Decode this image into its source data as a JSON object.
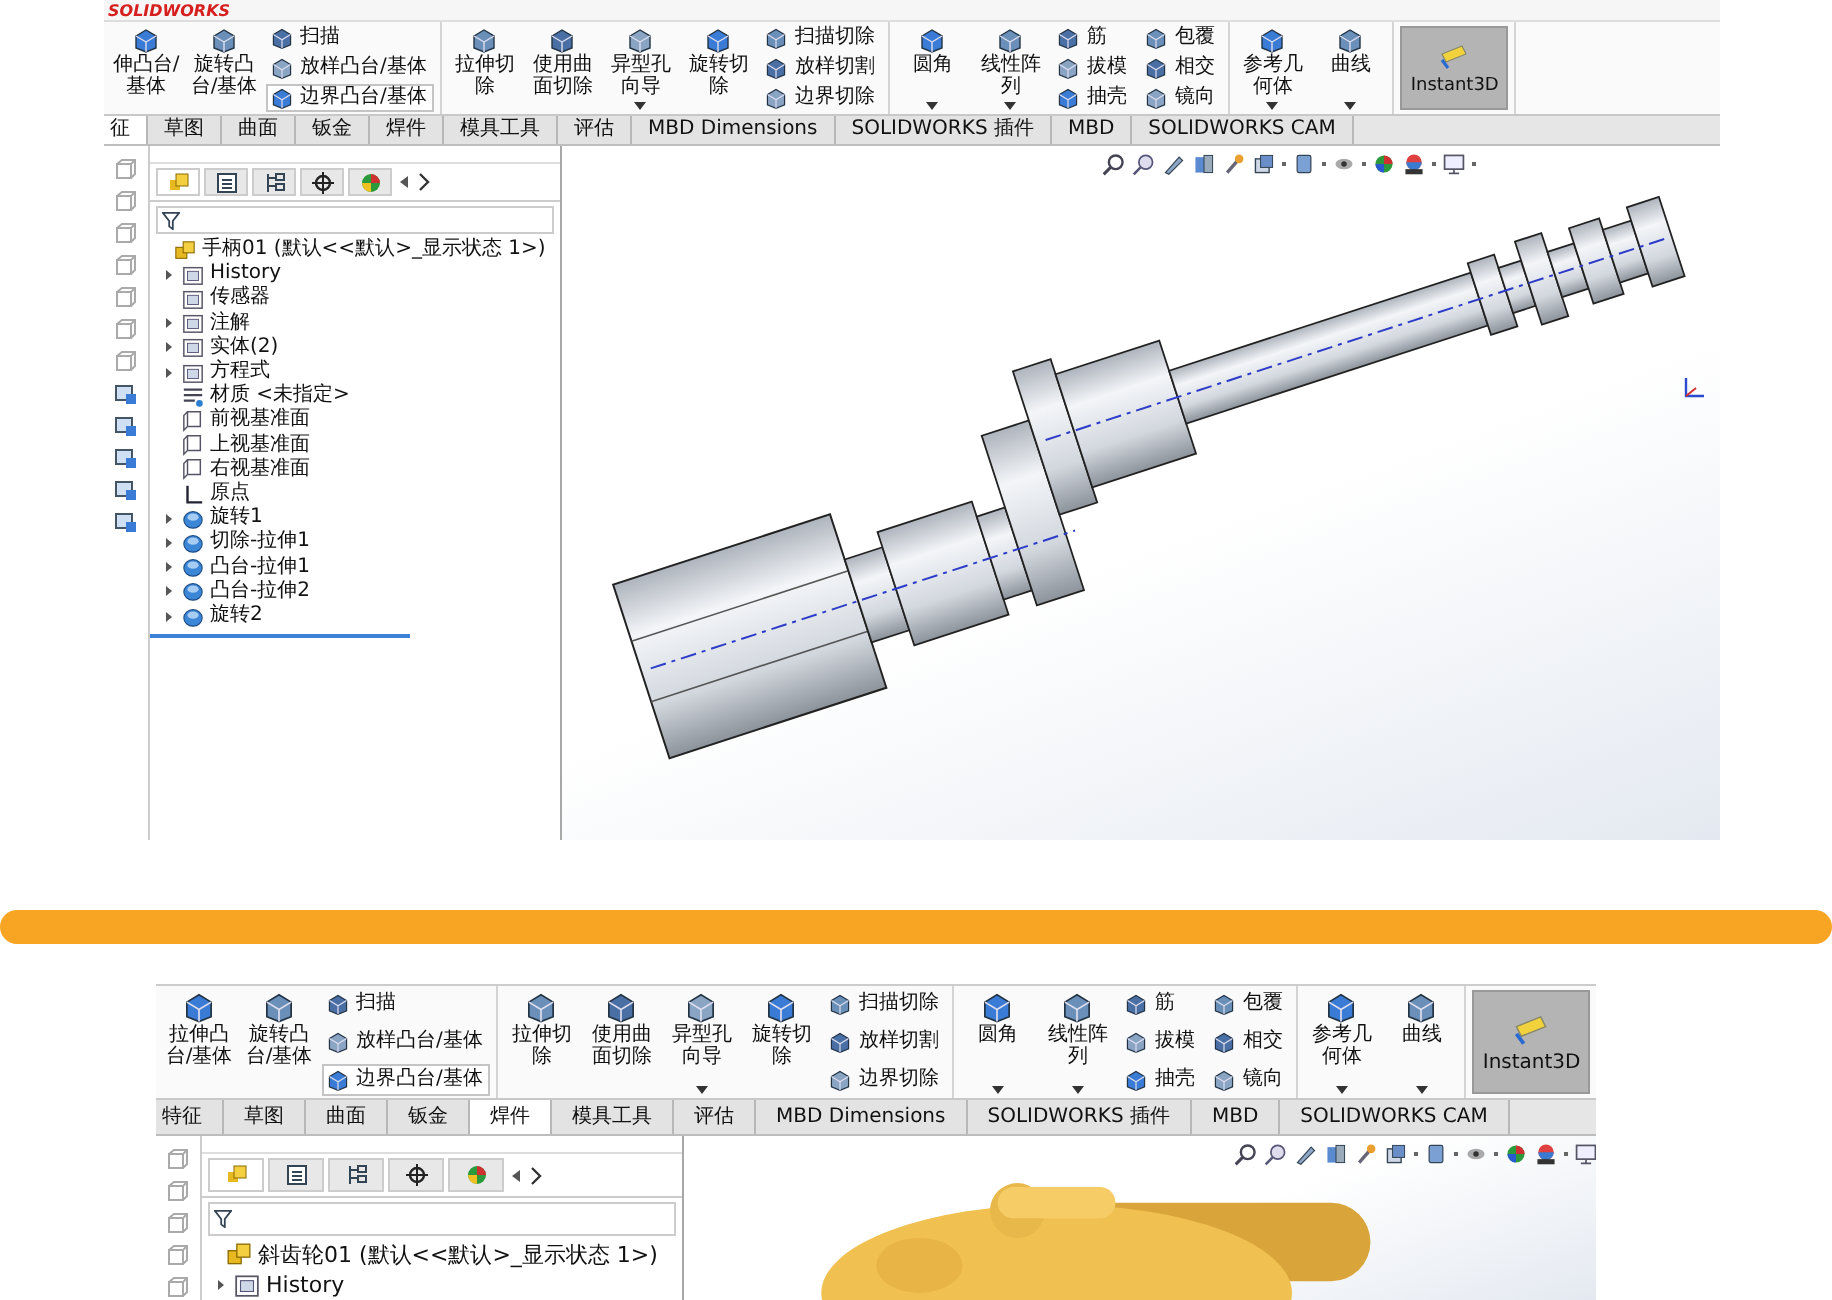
{
  "panels": [
    {
      "logo": "SOLIDWORKS",
      "ribbon": [
        {
          "items": [
            {
              "kind": "large",
              "label": "伸凸台/基体",
              "dropdown": false
            },
            {
              "kind": "large",
              "label": "旋转凸台/基体",
              "dropdown": false
            },
            {
              "kind": "stack",
              "entries": [
                {
                  "label": "扫描",
                  "highlighted": false
                },
                {
                  "label": "放样凸台/基体",
                  "highlighted": false
                },
                {
                  "label": "边界凸台/基体",
                  "highlighted": true
                }
              ]
            }
          ]
        },
        {
          "items": [
            {
              "kind": "large",
              "label": "拉伸切除",
              "dropdown": false
            },
            {
              "kind": "large",
              "label": "使用曲面切除",
              "dropdown": false
            },
            {
              "kind": "large",
              "label": "异型孔向导",
              "dropdown": true
            },
            {
              "kind": "large",
              "label": "旋转切除",
              "dropdown": false
            },
            {
              "kind": "stack",
              "entries": [
                {
                  "label": "扫描切除",
                  "highlighted": false
                },
                {
                  "label": "放样切割",
                  "highlighted": false
                },
                {
                  "label": "边界切除",
                  "highlighted": false
                }
              ]
            }
          ]
        },
        {
          "items": [
            {
              "kind": "large",
              "label": "圆角",
              "dropdown": true
            },
            {
              "kind": "large",
              "label": "线性阵列",
              "dropdown": true
            },
            {
              "kind": "stack",
              "entries": [
                {
                  "label": "筋",
                  "highlighted": false
                },
                {
                  "label": "拔模",
                  "highlighted": false
                },
                {
                  "label": "抽壳",
                  "highlighted": false
                }
              ]
            },
            {
              "kind": "stack",
              "entries": [
                {
                  "label": "包覆",
                  "highlighted": false
                },
                {
                  "label": "相交",
                  "highlighted": false
                },
                {
                  "label": "镜向",
                  "highlighted": false
                }
              ]
            }
          ]
        },
        {
          "items": [
            {
              "kind": "large",
              "label": "参考几何体",
              "dropdown": true
            },
            {
              "kind": "large",
              "label": "曲线",
              "dropdown": true
            }
          ]
        },
        {
          "items": [
            {
              "kind": "toggle",
              "label": "Instant3D",
              "pressed": true
            }
          ]
        }
      ],
      "tabs": [
        {
          "label": "征",
          "selected": true
        },
        {
          "label": "草图",
          "selected": false
        },
        {
          "label": "曲面",
          "selected": false
        },
        {
          "label": "钣金",
          "selected": false
        },
        {
          "label": "焊件",
          "selected": false
        },
        {
          "label": "模具工具",
          "selected": false
        },
        {
          "label": "评估",
          "selected": false
        },
        {
          "label": "MBD Dimensions",
          "selected": false
        },
        {
          "label": "SOLIDWORKS 插件",
          "selected": false
        },
        {
          "label": "MBD",
          "selected": false
        },
        {
          "label": "SOLIDWORKS CAM",
          "selected": false
        }
      ],
      "tree_tabs": [
        {
          "selected": true
        },
        {
          "selected": false
        },
        {
          "selected": false
        },
        {
          "selected": false
        },
        {
          "selected": false
        }
      ],
      "tree": [
        {
          "kind": "part",
          "label": "手柄01 (默认<<默认>_显示状态 1>)",
          "collapsible": false
        },
        {
          "kind": "folder",
          "label": "History",
          "collapsible": true
        },
        {
          "kind": "folder",
          "label": "传感器",
          "collapsible": false
        },
        {
          "kind": "folder",
          "label": "注解",
          "collapsible": true
        },
        {
          "kind": "folder",
          "label": "实体(2)",
          "collapsible": true
        },
        {
          "kind": "folder",
          "label": "方程式",
          "collapsible": true
        },
        {
          "kind": "material",
          "label": "材质 <未指定>",
          "collapsible": false
        },
        {
          "kind": "plane",
          "label": "前视基准面",
          "collapsible": false
        },
        {
          "kind": "plane",
          "label": "上视基准面",
          "collapsible": false
        },
        {
          "kind": "plane",
          "label": "右视基准面",
          "collapsible": false
        },
        {
          "kind": "origin",
          "label": "原点",
          "collapsible": false
        },
        {
          "kind": "feature",
          "label": "旋转1",
          "collapsible": true
        },
        {
          "kind": "feature",
          "label": "切除-拉伸1",
          "collapsible": true
        },
        {
          "kind": "feature",
          "label": "凸台-拉伸1",
          "collapsible": true
        },
        {
          "kind": "feature",
          "label": "凸台-拉伸2",
          "collapsible": true
        },
        {
          "kind": "feature",
          "label": "旋转2",
          "collapsible": true
        }
      ],
      "viewport": {
        "kind": "shaft"
      }
    },
    {
      "ribbon": [
        {
          "items": [
            {
              "kind": "large",
              "label": "拉伸凸台/基体",
              "dropdown": false
            },
            {
              "kind": "large",
              "label": "旋转凸台/基体",
              "dropdown": false
            },
            {
              "kind": "stack",
              "entries": [
                {
                  "label": "扫描",
                  "highlighted": false
                },
                {
                  "label": "放样凸台/基体",
                  "highlighted": false
                },
                {
                  "label": "边界凸台/基体",
                  "highlighted": true
                }
              ]
            }
          ]
        },
        {
          "items": [
            {
              "kind": "large",
              "label": "拉伸切除",
              "dropdown": false
            },
            {
              "kind": "large",
              "label": "使用曲面切除",
              "dropdown": false
            },
            {
              "kind": "large",
              "label": "异型孔向导",
              "dropdown": true
            },
            {
              "kind": "large",
              "label": "旋转切除",
              "dropdown": false
            },
            {
              "kind": "stack",
              "entries": [
                {
                  "label": "扫描切除",
                  "highlighted": false
                },
                {
                  "label": "放样切割",
                  "highlighted": false
                },
                {
                  "label": "边界切除",
                  "highlighted": false
                }
              ]
            }
          ]
        },
        {
          "items": [
            {
              "kind": "large",
              "label": "圆角",
              "dropdown": true
            },
            {
              "kind": "large",
              "label": "线性阵列",
              "dropdown": true
            },
            {
              "kind": "stack",
              "entries": [
                {
                  "label": "筋",
                  "highlighted": false
                },
                {
                  "label": "拔模",
                  "highlighted": false
                },
                {
                  "label": "抽壳",
                  "highlighted": false
                }
              ]
            },
            {
              "kind": "stack",
              "entries": [
                {
                  "label": "包覆",
                  "highlighted": false
                },
                {
                  "label": "相交",
                  "highlighted": false
                },
                {
                  "label": "镜向",
                  "highlighted": false
                }
              ]
            }
          ]
        },
        {
          "items": [
            {
              "kind": "large",
              "label": "参考几何体",
              "dropdown": true
            },
            {
              "kind": "large",
              "label": "曲线",
              "dropdown": true
            }
          ]
        },
        {
          "items": [
            {
              "kind": "toggle",
              "label": "Instant3D",
              "pressed": true
            }
          ]
        }
      ],
      "tabs": [
        {
          "label": "特征",
          "selected": false
        },
        {
          "label": "草图",
          "selected": false
        },
        {
          "label": "曲面",
          "selected": false
        },
        {
          "label": "钣金",
          "selected": false
        },
        {
          "label": "焊件",
          "selected": true
        },
        {
          "label": "模具工具",
          "selected": false
        },
        {
          "label": "评估",
          "selected": false
        },
        {
          "label": "MBD Dimensions",
          "selected": false
        },
        {
          "label": "SOLIDWORKS 插件",
          "selected": false
        },
        {
          "label": "MBD",
          "selected": false
        },
        {
          "label": "SOLIDWORKS CAM",
          "selected": false
        }
      ],
      "tree_tabs": [
        {
          "selected": true
        },
        {
          "selected": false
        },
        {
          "selected": false
        },
        {
          "selected": false
        },
        {
          "selected": false
        }
      ],
      "tree": [
        {
          "kind": "part",
          "label": "斜齿轮01 (默认<<默认>_显示状态 1>)",
          "collapsible": false
        },
        {
          "kind": "folder",
          "label": "History",
          "collapsible": true
        }
      ],
      "viewport": {
        "kind": "gear"
      }
    }
  ]
}
